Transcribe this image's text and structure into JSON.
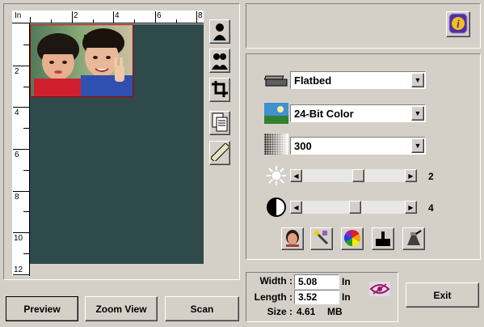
{
  "ruler": {
    "unit": "In",
    "top_ticks": [
      "2",
      "4",
      "6",
      "8"
    ],
    "left_ticks": [
      "2",
      "4",
      "6",
      "8",
      "10",
      "12"
    ]
  },
  "tools": [
    "portrait-icon",
    "auto-crop-icon",
    "crop-icon",
    "multi-page-icon",
    "ruler-icon"
  ],
  "settings": {
    "scan_source": "Flatbed",
    "color_mode": "24-Bit Color",
    "resolution": "300",
    "brightness_value": "2",
    "contrast_value": "4",
    "brightness_level": 0.55,
    "contrast_level": 0.52
  },
  "adjust_icons": [
    "auto-level-icon",
    "magic-wand-icon",
    "color-balance-icon",
    "tone-curve-icon",
    "scanner-settings-icon"
  ],
  "dimensions": {
    "width_label": "Width :",
    "width_value": "5.08",
    "width_unit": "In",
    "length_label": "Length :",
    "length_value": "3.52",
    "length_unit": "In",
    "size_label": "Size :",
    "size_value": "4.61",
    "size_unit": "MB"
  },
  "buttons": {
    "preview": "Preview",
    "zoom_view": "Zoom View",
    "scan": "Scan",
    "exit": "Exit"
  },
  "colors": {
    "scan_bed": "#2f4a4a",
    "window_bg": "#d4d0c8",
    "info_button": "#5030a0"
  }
}
